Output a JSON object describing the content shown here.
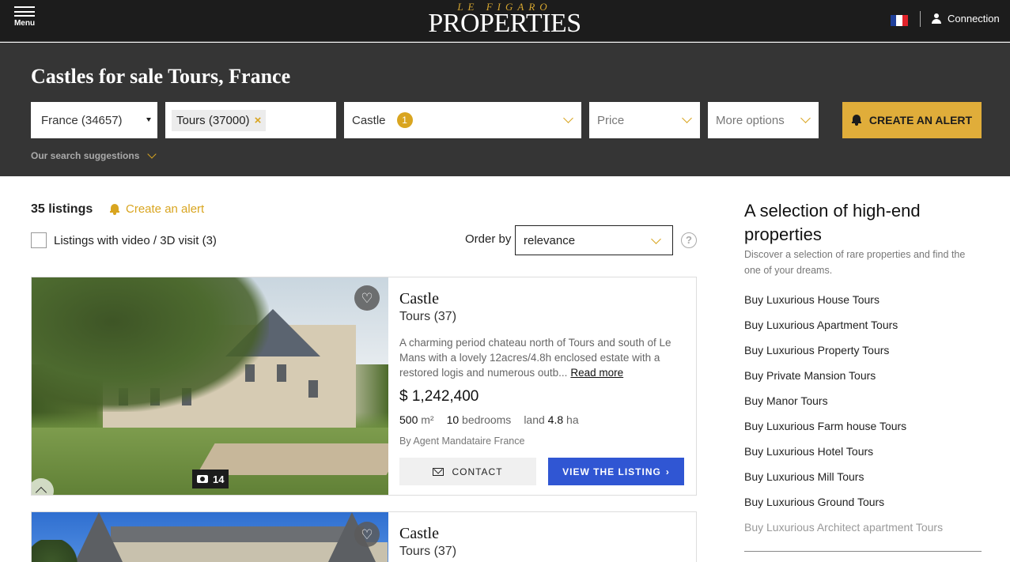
{
  "header": {
    "menu_label": "Menu",
    "logo_small": "LE FIGARO",
    "logo_big": "PROPERTIES",
    "connection_label": "Connection",
    "flag_colors": [
      "#1f3f9a",
      "#ffffff",
      "#e1222a"
    ]
  },
  "search": {
    "title": "Castles for sale Tours, France",
    "country_value": "France (34657)",
    "city_chip": "Tours (37000)",
    "city_remove": "×",
    "type_value": "Castle",
    "type_count": "1",
    "price_placeholder": "Price",
    "more_placeholder": "More options",
    "alert_button": "CREATE AN ALERT",
    "suggestions_label": "Our search suggestions"
  },
  "listing_header": {
    "count": "35 listings",
    "create_alert": "Create an alert",
    "video_filter": "Listings with video / 3D visit (3)",
    "order_label": "Order by",
    "order_value": "relevance",
    "help": "?"
  },
  "listings": [
    {
      "title": "Castle",
      "location": "Tours (37)",
      "description": "A charming period chateau north of Tours and south of Le Mans with a lovely 12acres/4.8h enclosed estate with a restored logis and numerous outb...",
      "read_more": "Read more",
      "price": "$ 1,242,400",
      "area_value": "500",
      "area_unit": "m²",
      "bedrooms_value": "10",
      "bedrooms_label": "bedrooms",
      "land_label": "land",
      "land_value": "4.8",
      "land_unit": "ha",
      "agent": "By Agent Mandataire France",
      "photo_count": "14",
      "contact_label": "CONTACT",
      "view_label": "VIEW THE LISTING",
      "view_arrow": "›"
    },
    {
      "title": "Castle",
      "location": "Tours (37)"
    }
  ],
  "sidebar": {
    "title": "A selection of high-end properties",
    "subtitle": "Discover a selection of rare properties and find the one of your dreams.",
    "links": [
      "Buy Luxurious House Tours",
      "Buy Luxurious Apartment Tours",
      "Buy Luxurious Property Tours",
      "Buy Private Mansion Tours",
      "Buy Manor Tours",
      "Buy Luxurious Farm house Tours",
      "Buy Luxurious Hotel Tours",
      "Buy Luxurious Mill Tours",
      "Buy Luxurious Ground Tours",
      "Buy Luxurious Architect apartment Tours"
    ]
  },
  "colors": {
    "accent": "#d9a520",
    "primary_button": "#3056d3",
    "header_bg": "#1c1c1c",
    "search_bg": "#353535"
  }
}
